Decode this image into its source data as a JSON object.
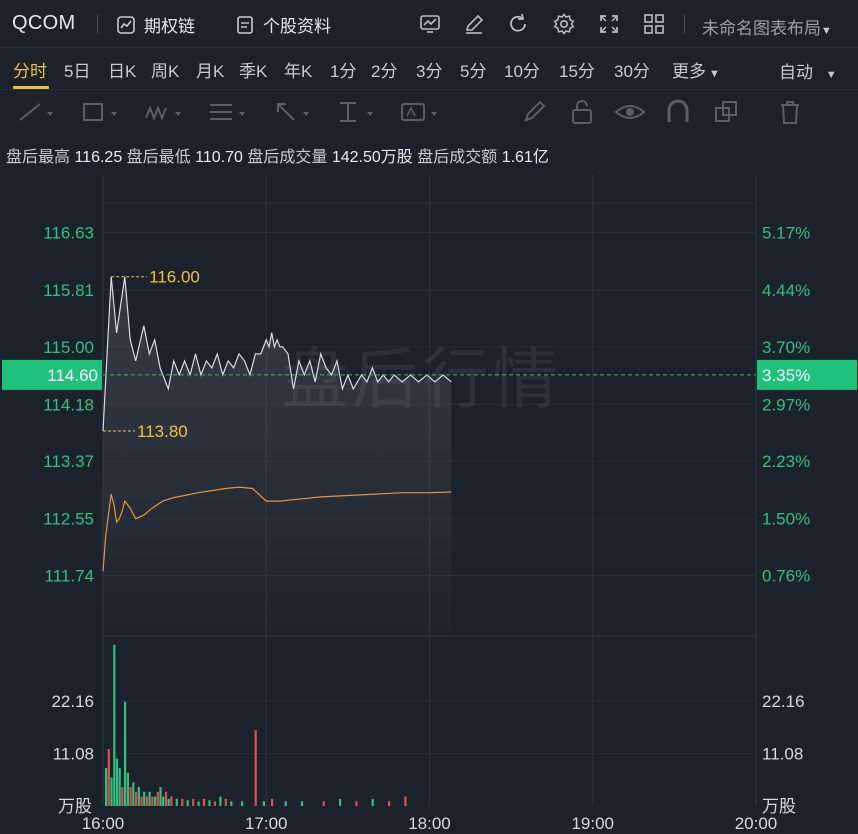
{
  "header": {
    "ticker": "QCOM",
    "options_chain": "期权链",
    "profile": "个股资料",
    "layout_name": "未命名图表布局"
  },
  "periods": [
    "分时",
    "5日",
    "日K",
    "周K",
    "月K",
    "季K",
    "年K",
    "1分",
    "2分",
    "3分",
    "5分",
    "10分",
    "15分",
    "30分",
    "更多"
  ],
  "active_period": "分时",
  "mode": "自动",
  "stats": {
    "high_label": "盘后最高",
    "high": "116.25",
    "low_label": "盘后最低",
    "low": "110.70",
    "vol_label": "盘后成交量",
    "vol": "142.50万股",
    "amount_label": "盘后成交额",
    "amount": "1.61亿"
  },
  "watermark": "盘后行情",
  "colors": {
    "up": "#2ec27e",
    "down": "#e04f4f",
    "price_line": "#d8dbe0",
    "avg_line": "#e8943a",
    "accent": "#f0c23c",
    "current_badge": "#1fc27a"
  },
  "chart_data": {
    "type": "line",
    "x_ticks": [
      "16:00",
      "17:00",
      "18:00",
      "19:00",
      "20:00"
    ],
    "x_range": [
      "16:00",
      "20:00"
    ],
    "price_axis": {
      "ticks": [
        "116.63",
        "115.81",
        "115.00",
        "114.18",
        "113.37",
        "112.55",
        "111.74"
      ],
      "ylim": [
        110.92,
        117.45
      ]
    },
    "pct_axis": {
      "ticks": [
        "5.17%",
        "4.44%",
        "3.70%",
        "2.97%",
        "2.23%",
        "1.50%",
        "0.76%"
      ]
    },
    "prev_close": 110.8,
    "current": {
      "price": "114.60",
      "pct": "3.35%"
    },
    "annotations": {
      "high_mark": "116.00",
      "low_mark": "113.80"
    },
    "price_series": {
      "t_min": [
        0,
        3,
        5,
        8,
        10,
        12,
        15,
        17,
        19,
        21,
        24,
        26,
        28,
        30,
        32,
        34,
        36,
        38,
        40,
        42,
        44,
        46,
        48,
        50,
        52,
        54,
        56,
        58,
        60,
        61,
        62,
        63,
        64,
        65,
        66,
        68,
        70,
        72,
        74,
        76,
        78,
        80,
        82,
        84,
        86,
        88,
        90,
        92,
        95,
        97,
        99,
        101,
        103,
        105,
        107,
        110,
        113,
        116,
        119,
        122,
        125,
        128
      ],
      "values": [
        113.8,
        116.0,
        115.2,
        116.0,
        115.1,
        114.8,
        115.3,
        114.9,
        115.1,
        114.7,
        114.4,
        114.8,
        114.6,
        114.8,
        114.6,
        114.9,
        114.6,
        114.8,
        114.7,
        114.9,
        114.6,
        114.8,
        114.7,
        114.9,
        114.8,
        114.6,
        114.9,
        114.9,
        115.1,
        115.0,
        115.2,
        115.0,
        115.1,
        115.0,
        115.0,
        114.9,
        114.4,
        114.8,
        114.6,
        114.8,
        114.5,
        114.9,
        114.7,
        114.6,
        114.8,
        114.4,
        114.6,
        114.4,
        114.6,
        114.5,
        114.7,
        114.5,
        114.6,
        114.5,
        114.6,
        114.5,
        114.6,
        114.5,
        114.6,
        114.5,
        114.6,
        114.5
      ]
    },
    "avg_series": {
      "t_min": [
        0,
        1,
        2,
        3,
        4,
        5,
        6,
        7,
        8,
        10,
        12,
        15,
        18,
        22,
        26,
        30,
        35,
        40,
        45,
        50,
        55,
        60,
        65,
        70,
        75,
        80,
        90,
        100,
        110,
        120,
        128
      ],
      "values": [
        111.8,
        112.3,
        112.6,
        112.9,
        112.75,
        112.5,
        112.55,
        112.65,
        112.8,
        112.7,
        112.55,
        112.6,
        112.7,
        112.8,
        112.85,
        112.88,
        112.92,
        112.95,
        112.98,
        113.0,
        112.98,
        112.8,
        112.8,
        112.82,
        112.84,
        112.86,
        112.88,
        112.9,
        112.92,
        112.92,
        112.93
      ]
    },
    "volume_axis": {
      "ticks": [
        "22.16",
        "11.08"
      ],
      "unit": "万股",
      "ylim": [
        0,
        35
      ]
    },
    "volume_series": {
      "t_min": [
        0,
        1,
        2,
        3,
        4,
        5,
        6,
        7,
        8,
        9,
        10,
        11,
        12,
        13,
        14,
        15,
        16,
        17,
        18,
        19,
        20,
        21,
        22,
        23,
        24,
        26,
        28,
        30,
        32,
        34,
        36,
        38,
        40,
        42,
        44,
        46,
        50,
        55,
        58,
        61,
        66,
        72,
        80,
        86,
        92,
        98,
        104,
        110
      ],
      "values": [
        8,
        12,
        6,
        34,
        10,
        8,
        4,
        22,
        7,
        4,
        5,
        3,
        4,
        2,
        3,
        2,
        3,
        2,
        2,
        3,
        4,
        2,
        3,
        1.5,
        2,
        1.5,
        1.5,
        1.2,
        1.5,
        1,
        1.5,
        1.2,
        1,
        2,
        1.5,
        1,
        1,
        16,
        1,
        1.5,
        1,
        1,
        1,
        1.5,
        1,
        1.5,
        1,
        2
      ],
      "colors": [
        "up",
        "down",
        "up",
        "up",
        "up",
        "up",
        "down",
        "up",
        "up",
        "down",
        "up",
        "down",
        "up",
        "down",
        "up",
        "down",
        "up",
        "down",
        "up",
        "down",
        "up",
        "up",
        "down",
        "up",
        "down",
        "up",
        "down",
        "up",
        "down",
        "up",
        "down",
        "up",
        "down",
        "up",
        "down",
        "up",
        "up",
        "down",
        "up",
        "down",
        "up",
        "up",
        "down",
        "up",
        "down",
        "up",
        "down",
        "down"
      ]
    }
  }
}
